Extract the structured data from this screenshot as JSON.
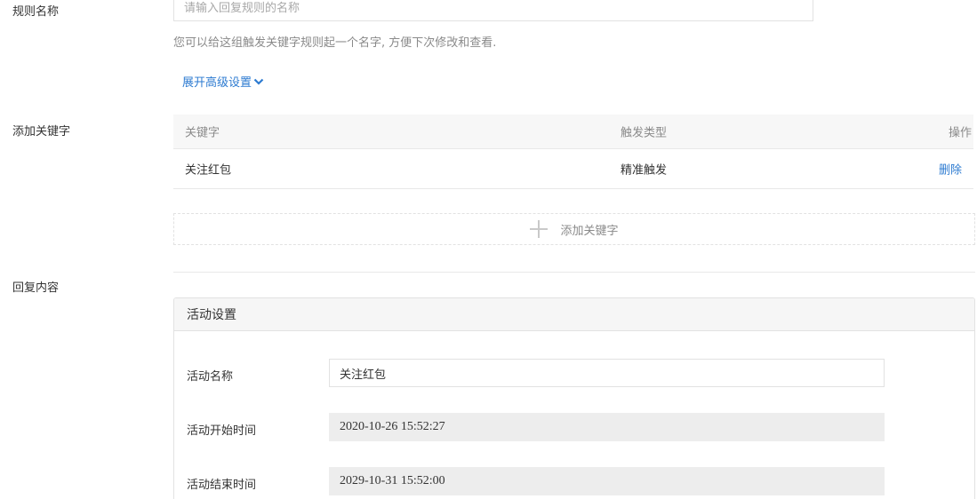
{
  "form": {
    "rule_name": {
      "label": "规则名称",
      "placeholder": "请输入回复规则的名称",
      "value": "",
      "hint": "您可以给这组触发关键字规则起一个名字, 方便下次修改和查看."
    },
    "expand_advanced_label": "展开高级设置",
    "keywords": {
      "label": "添加关键字",
      "columns": [
        "关键字",
        "触发类型",
        "操作"
      ],
      "rows": [
        {
          "keyword": "关注红包",
          "trigger_type": "精准触发",
          "action": "删除"
        }
      ],
      "add_label": "添加关键字"
    },
    "reply_content": {
      "label": "回复内容"
    }
  },
  "activity": {
    "title": "活动设置",
    "name_label": "活动名称",
    "name_value": "关注红包",
    "start_label": "活动开始时间",
    "start_value": "2020-10-26 15:52:27",
    "end_label": "活动结束时间",
    "end_value": "2029-10-31 15:52:00"
  },
  "colors": {
    "link": "#2d7bd1",
    "muted": "#8a8a8a",
    "border": "#e2e2e2"
  }
}
